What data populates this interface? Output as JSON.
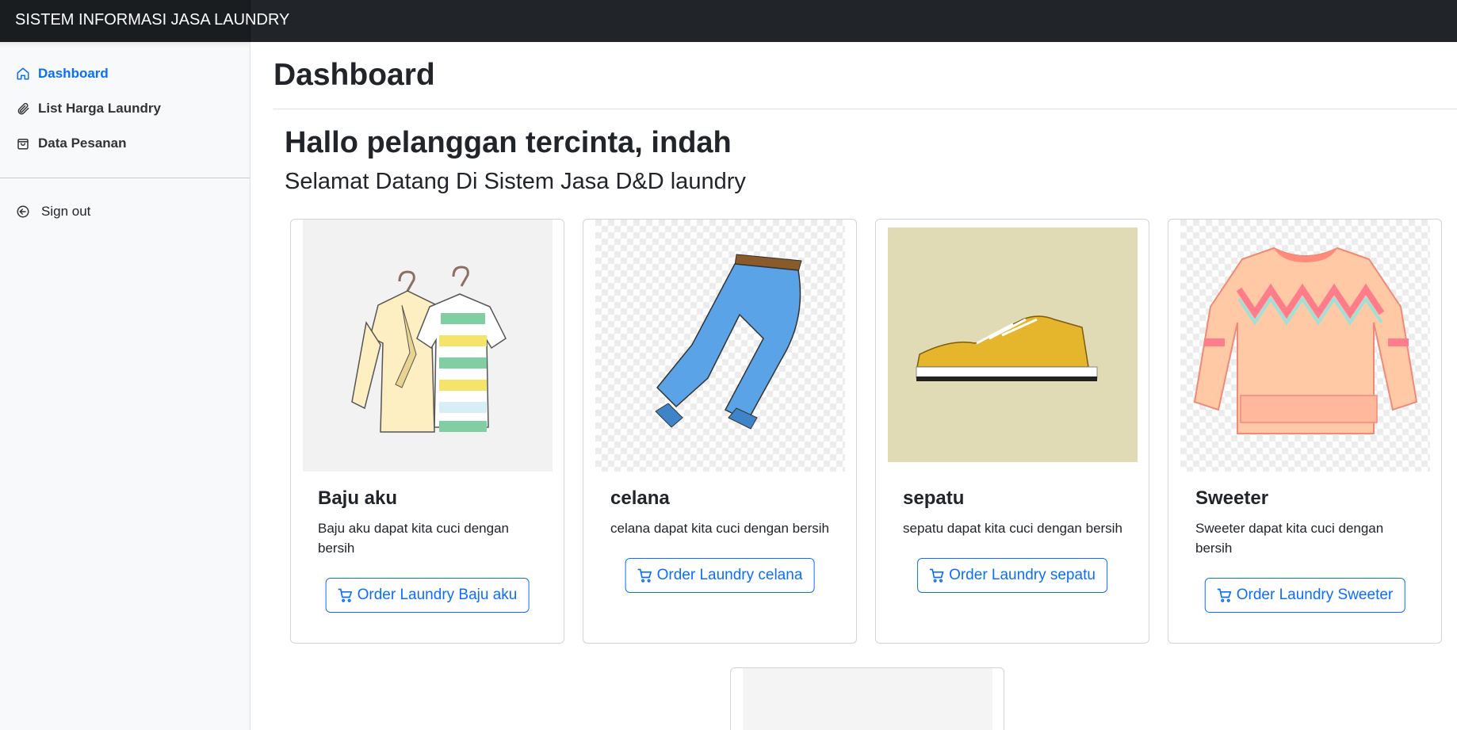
{
  "topbar": {
    "brand": "SISTEM INFORMASI JASA LAUNDRY"
  },
  "sidebar": {
    "items": [
      {
        "label": "Dashboard",
        "icon": "home-icon",
        "active": true
      },
      {
        "label": "List Harga Laundry",
        "icon": "paperclip-icon",
        "active": false
      },
      {
        "label": "Data Pesanan",
        "icon": "shopping-bag-icon",
        "active": false
      }
    ],
    "signout": {
      "label": "Sign out",
      "icon": "arrow-left-circle-icon"
    }
  },
  "main": {
    "title": "Dashboard",
    "greeting": "Hallo pelanggan tercinta, indah",
    "welcome": "Selamat Datang Di Sistem Jasa D&D laundry"
  },
  "cards": [
    {
      "name": "Baju aku",
      "desc": "Baju aku dapat kita cuci dengan bersih",
      "button": "Order Laundry Baju aku",
      "image": "clothes-on-hangers"
    },
    {
      "name": "celana",
      "desc": "celana dapat kita cuci dengan bersih",
      "button": "Order Laundry celana",
      "image": "blue-jeans"
    },
    {
      "name": "sepatu",
      "desc": "sepatu dapat kita cuci dengan bersih",
      "button": "Order Laundry sepatu",
      "image": "yellow-sneaker"
    },
    {
      "name": "Sweeter",
      "desc": "Sweeter dapat kita cuci dengan bersih",
      "button": "Order Laundry Sweeter",
      "image": "pink-sweater"
    }
  ],
  "colors": {
    "primary": "#0d6efd",
    "topbar": "#212529",
    "sidebar_bg": "#f8f9fa"
  }
}
